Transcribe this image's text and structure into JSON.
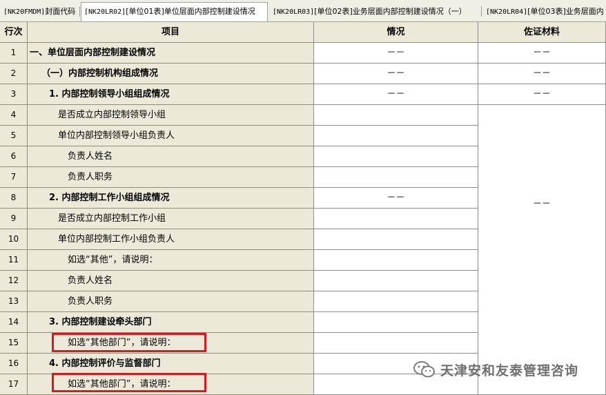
{
  "tabs": [
    {
      "code": "[NK20FMDM]",
      "label": "封面代码",
      "active": false
    },
    {
      "code": "[NK20LR02]",
      "label": "[单位01表]单位层面内部控制建设情况",
      "active": true
    },
    {
      "code": "[NK20LR03]",
      "label": "[单位02表]业务层面内部控制建设情况（一）",
      "active": false
    },
    {
      "code": "[NK20LR04]",
      "label": "[单位03表]业务层面内",
      "active": false
    }
  ],
  "columns": {
    "num": "行次",
    "item": "项目",
    "situation": "情况",
    "material": "佐证材料"
  },
  "rows": [
    {
      "num": "1",
      "item": "一、单位层面内部控制建设情况",
      "situation": "－－",
      "material": "－－"
    },
    {
      "num": "2",
      "item": "（一）内部控制机构组成情况",
      "situation": "－－",
      "material": "－－"
    },
    {
      "num": "3",
      "item": "1. 内部控制领导小组组成情况",
      "situation": "－－",
      "material": "－－"
    },
    {
      "num": "4",
      "item": "是否成立内部控制领导小组",
      "situation": ""
    },
    {
      "num": "5",
      "item": "单位内部控制领导小组负责人",
      "situation": ""
    },
    {
      "num": "6",
      "item": "负责人姓名",
      "situation": ""
    },
    {
      "num": "7",
      "item": "负责人职务",
      "situation": ""
    },
    {
      "num": "8",
      "item": "2. 内部控制工作小组组成情况",
      "situation": "－－"
    },
    {
      "num": "9",
      "item": "是否成立内部控制工作小组",
      "situation": ""
    },
    {
      "num": "10",
      "item": "单位内部控制工作小组负责人",
      "situation": ""
    },
    {
      "num": "11",
      "item": "如选“其他”，请说明：",
      "situation": ""
    },
    {
      "num": "12",
      "item": "负责人姓名",
      "situation": ""
    },
    {
      "num": "13",
      "item": "负责人职务",
      "situation": ""
    },
    {
      "num": "14",
      "item": "3. 内部控制建设牵头部门",
      "situation": ""
    },
    {
      "num": "15",
      "item": "如选“其他部门”，请说明：",
      "situation": ""
    },
    {
      "num": "16",
      "item": "4. 内部控制评价与监督部门",
      "situation": ""
    },
    {
      "num": "17",
      "item": "如选“其他部门”，请说明：",
      "situation": ""
    }
  ],
  "merged_material": "－－",
  "watermark": "天津安和友泰管理咨询",
  "colors": {
    "header_bg": "#ece9d8",
    "grid_line": "#8c8c8c",
    "highlight": "#e0161d"
  }
}
